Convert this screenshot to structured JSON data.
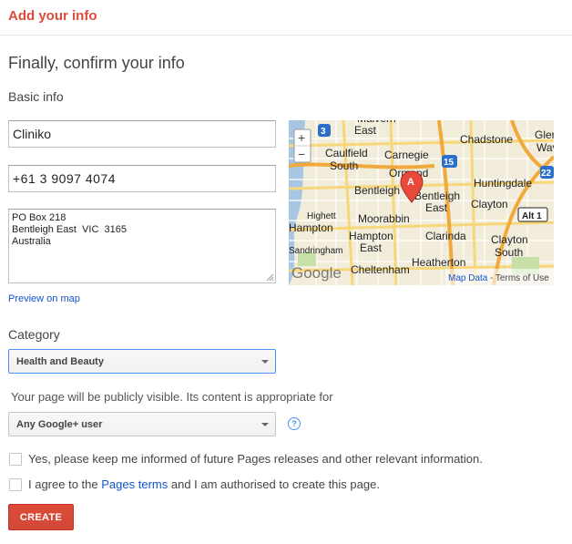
{
  "header": {
    "title": "Add your info"
  },
  "page": {
    "title": "Finally, confirm your info"
  },
  "basic_info": {
    "label": "Basic info",
    "name_value": "Cliniko",
    "phone_value": "+61 3 9097 4074",
    "address_value": "PO Box 218\nBentleigh East  VIC  3165\nAustralia",
    "preview_link": "Preview on map"
  },
  "map": {
    "zoom_in": "+",
    "zoom_out": "−",
    "marker_label": "A",
    "logo": "Google",
    "attribution_link": "Map Data",
    "attribution_rest": "- Terms of Use",
    "places": [
      "Malvern East",
      "Chadstone",
      "Glen Wave",
      "Caulfield South",
      "Carnegie",
      "Ormond",
      "Bentleigh",
      "Bentleigh East",
      "Huntingdale",
      "Clayton",
      "Moorabbin",
      "Hampton",
      "Hampton East",
      "Clarinda",
      "Clayton South",
      "Highett",
      "Heatherton",
      "Cheltenham",
      "Sandringham"
    ],
    "road_shields": [
      "3",
      "15",
      "22",
      "Alt 1"
    ]
  },
  "category": {
    "label": "Category",
    "selected": "Health and Beauty"
  },
  "visibility": {
    "text": "Your page will be publicly visible. Its content is appropriate for",
    "selected": "Any Google+ user",
    "help": "?"
  },
  "options": {
    "updates_label": "Yes, please keep me informed of future Pages releases and other relevant information.",
    "terms_prefix": "I agree to the",
    "terms_link": "Pages terms",
    "terms_suffix": "and I am authorised to create this page."
  },
  "actions": {
    "create_label": "CREATE"
  },
  "colors": {
    "accent_red": "#dd4b39",
    "link_blue": "#1155cc",
    "focus_blue": "#4d90fe"
  }
}
